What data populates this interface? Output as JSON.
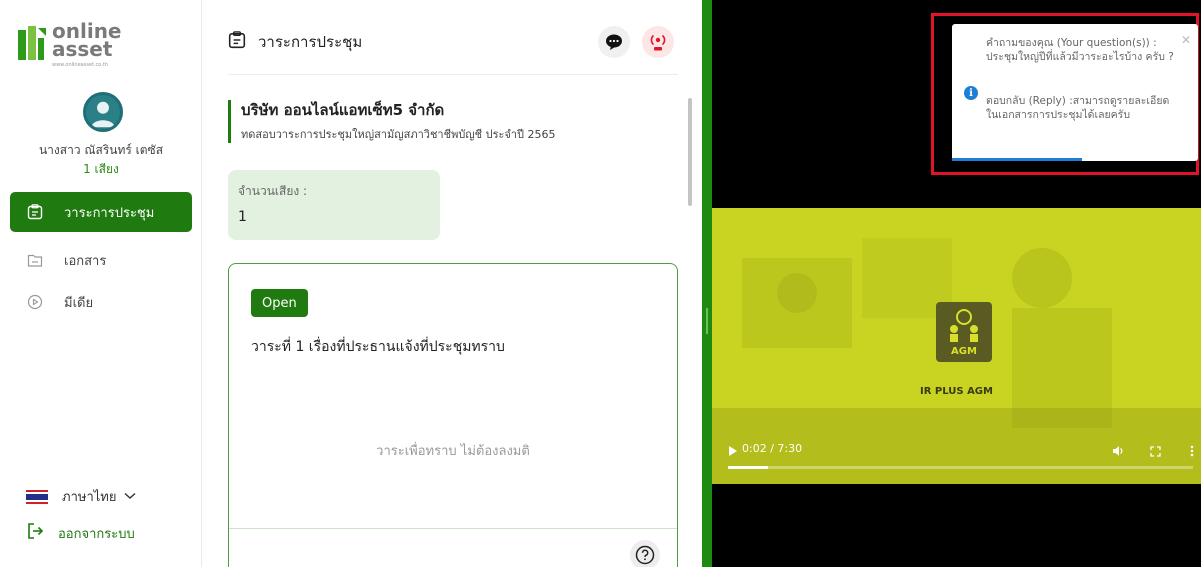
{
  "brand": {
    "logo_line1": "online",
    "logo_line2": "asset",
    "logo_url": "www.onlineasset.co.th"
  },
  "user": {
    "name": "นางสาว ณัสรินทร์ เตซัส",
    "votes": "1 เสียง"
  },
  "sidebar": {
    "items": [
      {
        "label": "วาระการประชุม",
        "icon": "agenda-icon",
        "active": true
      },
      {
        "label": "เอกสาร",
        "icon": "folder-icon",
        "active": false
      },
      {
        "label": "มีเดีย",
        "icon": "play-circle-icon",
        "active": false
      }
    ],
    "language": "ภาษาไทย",
    "logout": "ออกจากระบบ"
  },
  "main": {
    "header_title": "วาระการประชุม",
    "company_name": "บริษัท ออนไลน์แอทเซ็ท5 จำกัด",
    "company_subtitle": "ทดสอบวาระการประชุมใหญ่สามัญสภาวิชาชีพบัญชี ประจำปี 2565",
    "vote_label": "จำนวนเสียง :",
    "vote_value": "1",
    "agenda": {
      "status": "Open",
      "title": "วาระที่ 1 เรื่องที่ประธานแจ้งที่ประชุมทราบ",
      "note": "วาระเพื่อทราบ ไม่ต้องลงมติ"
    }
  },
  "video": {
    "caption": "IR PLUS AGM",
    "logo_text": "AGM",
    "time": "0:02 / 7:30",
    "progress_fraction": 0.0044
  },
  "notification": {
    "question_label": "คำถามของคุณ (Your question(s)) :",
    "question_text": "ประชุมใหญ่ปีที่แล้วมีวาระอะไรบ้าง ครับ ?",
    "reply_label": "ตอบกลับ (Reply) :",
    "reply_text": "สามารถดูรายละเอียดในเอกสารการประชุมได้เลยครับ"
  },
  "colors": {
    "brand_green": "#1f7a0f",
    "divider_green": "#1f8a10",
    "highlight_red": "#e3142a",
    "info_blue": "#1f7fd4",
    "video_bg": "#c8d421"
  }
}
